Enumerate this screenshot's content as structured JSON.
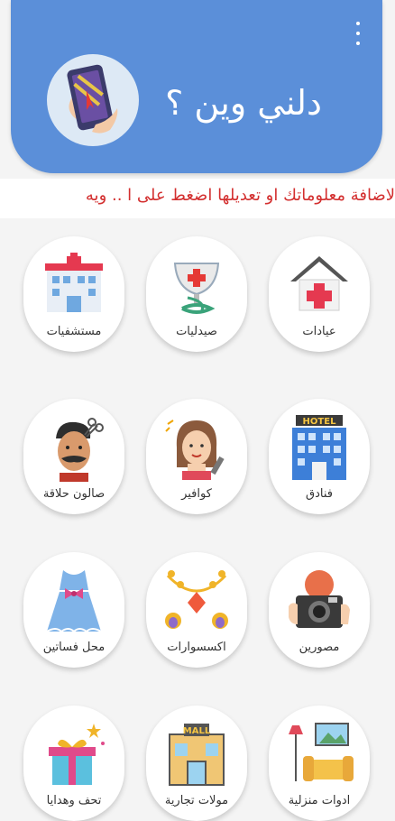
{
  "header": {
    "title": "دلني وين ؟",
    "menu_icon": "more-vert-icon",
    "background": "#5b8fd9"
  },
  "marquee": {
    "text": "لاضافة معلوماتك او تعديلها اضغط على ا .. ويه",
    "color": "#d32f2f"
  },
  "categories": [
    {
      "label": "عيادات",
      "icon": "clinic-icon"
    },
    {
      "label": "صيدليات",
      "icon": "pharmacy-icon"
    },
    {
      "label": "مستشفيات",
      "icon": "hospital-icon"
    },
    {
      "label": "فنادق",
      "icon": "hotel-icon"
    },
    {
      "label": "كوافير",
      "icon": "hair-stylist-icon"
    },
    {
      "label": "صالون حلاقة",
      "icon": "barber-icon"
    },
    {
      "label": "مصورين",
      "icon": "photographer-icon"
    },
    {
      "label": "اكسسوارات",
      "icon": "accessories-icon"
    },
    {
      "label": "محل فساتين",
      "icon": "dress-shop-icon"
    },
    {
      "label": "ادوات منزلية",
      "icon": "home-tools-icon"
    },
    {
      "label": "مولات تجارية",
      "icon": "mall-icon"
    },
    {
      "label": "تحف وهدايا",
      "icon": "gifts-icon"
    }
  ]
}
